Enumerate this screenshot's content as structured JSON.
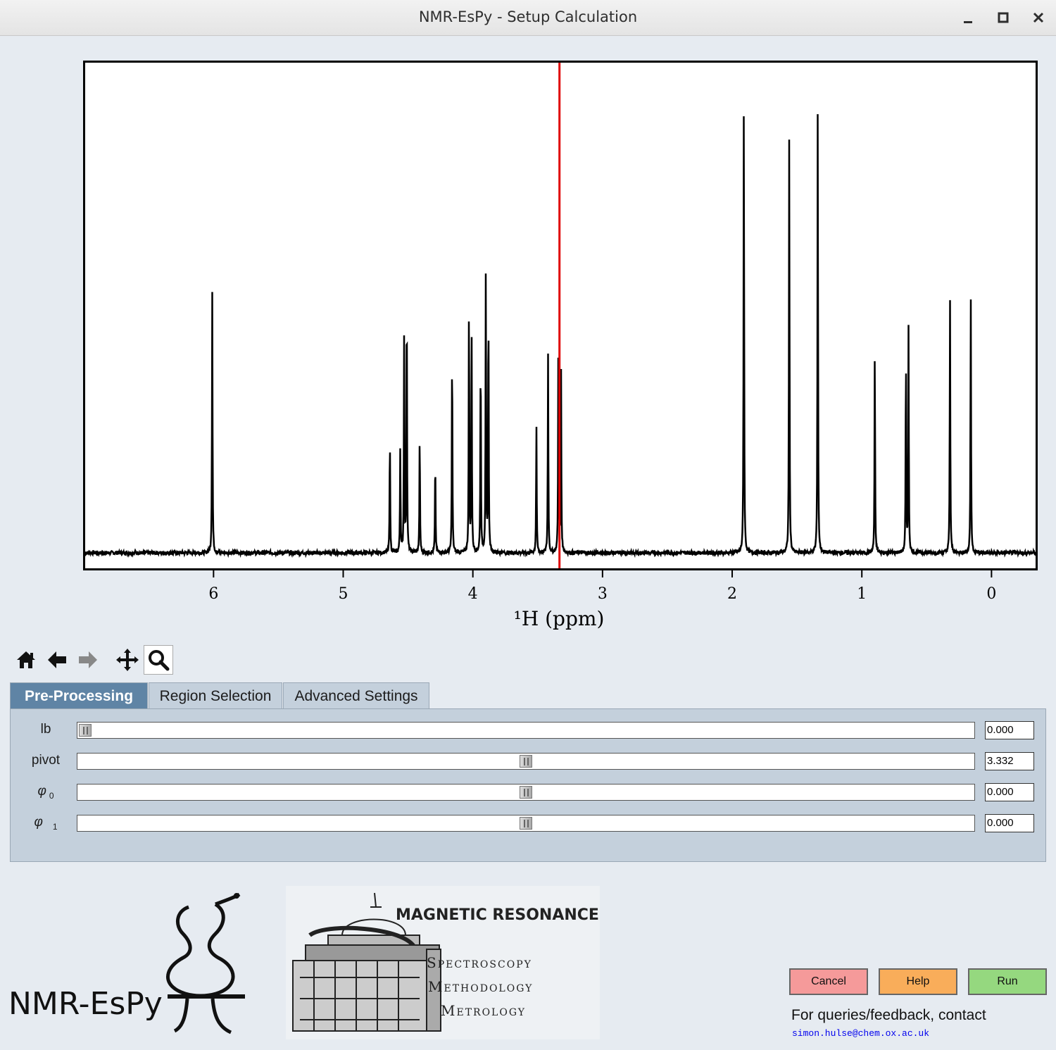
{
  "window": {
    "title": "NMR-EsPy - Setup Calculation",
    "minimize_icon": "minimize-icon",
    "maximize_icon": "maximize-icon",
    "close_icon": "close-icon"
  },
  "plot": {
    "xlabel": "¹H (ppm)",
    "xticks": [
      "6",
      "5",
      "4",
      "3",
      "2",
      "1",
      "0"
    ],
    "cursor_ppm": 3.332,
    "cursor_color": "#e00000",
    "line_color": "#000000"
  },
  "chart_data": {
    "type": "line",
    "title": "",
    "xlabel": "¹H (ppm)",
    "ylabel": "",
    "xlim": [
      6.99,
      -0.34
    ],
    "ylim": [
      0,
      1
    ],
    "x_reversed": true,
    "peaks": [
      {
        "ppm": 6.01,
        "height": 0.55
      },
      {
        "ppm": 4.64,
        "height": 0.25
      },
      {
        "ppm": 4.56,
        "height": 0.22
      },
      {
        "ppm": 4.53,
        "height": 0.46
      },
      {
        "ppm": 4.51,
        "height": 0.56
      },
      {
        "ppm": 4.41,
        "height": 0.25
      },
      {
        "ppm": 4.29,
        "height": 0.2
      },
      {
        "ppm": 4.16,
        "height": 0.44
      },
      {
        "ppm": 4.03,
        "height": 0.53
      },
      {
        "ppm": 4.01,
        "height": 0.5
      },
      {
        "ppm": 3.94,
        "height": 0.43
      },
      {
        "ppm": 3.9,
        "height": 0.6
      },
      {
        "ppm": 3.88,
        "height": 0.53
      },
      {
        "ppm": 3.51,
        "height": 0.27
      },
      {
        "ppm": 3.42,
        "height": 0.42
      },
      {
        "ppm": 3.34,
        "height": 0.51
      },
      {
        "ppm": 3.32,
        "height": 0.39
      },
      {
        "ppm": 1.91,
        "height": 0.97
      },
      {
        "ppm": 1.56,
        "height": 0.89
      },
      {
        "ppm": 1.34,
        "height": 0.95
      },
      {
        "ppm": 0.9,
        "height": 0.43
      },
      {
        "ppm": 0.66,
        "height": 0.42
      },
      {
        "ppm": 0.64,
        "height": 0.47
      },
      {
        "ppm": 0.32,
        "height": 0.54
      },
      {
        "ppm": 0.16,
        "height": 0.55
      }
    ],
    "grid": false
  },
  "toolbar": {
    "home": "home-icon",
    "back": "back-arrow-icon",
    "forward": "forward-arrow-icon",
    "pan": "pan-icon",
    "zoom": "zoom-icon"
  },
  "tabs": [
    {
      "label": "Pre-Processing",
      "active": true
    },
    {
      "label": "Region Selection",
      "active": false
    },
    {
      "label": "Advanced Settings",
      "active": false
    }
  ],
  "sliders": [
    {
      "label": "lb",
      "sub": "",
      "value": "0.000",
      "position": 0.0
    },
    {
      "label": "pivot",
      "sub": "",
      "value": "3.332",
      "position": 0.5
    },
    {
      "label": "φ",
      "sub": "0",
      "value": "0.000",
      "position": 0.5
    },
    {
      "label": "φ",
      "sub": "1",
      "value": "0.000",
      "position": 0.5
    }
  ],
  "buttons": {
    "cancel": "Cancel",
    "help": "Help",
    "run": "Run",
    "cancel_color": "#f59a9a",
    "help_color": "#f9ad5a",
    "run_color": "#95d87f"
  },
  "footer": {
    "contact": "For queries/feedback, contact",
    "email": "simon.hulse@chem.ox.ac.uk",
    "espy_logo_text": "NMR-EsPy",
    "mr_title": "MAGNETIC RESONANCE",
    "mr_lines": [
      "Spectroscopy",
      "Methodology",
      "Metrology"
    ]
  }
}
